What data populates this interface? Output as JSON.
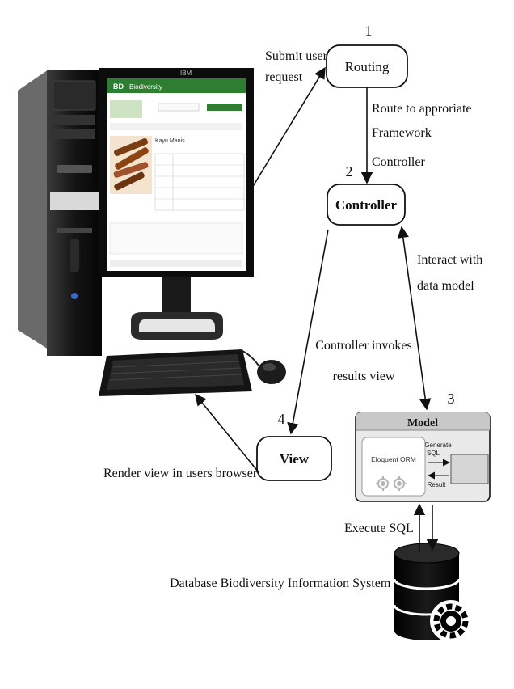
{
  "nodes": {
    "routing": {
      "number": "1",
      "label": "Routing"
    },
    "controller": {
      "number": "2",
      "label": "Controller"
    },
    "model": {
      "number": "3",
      "title": "Model",
      "orm_label": "Eloquent ORM"
    },
    "view": {
      "number": "4",
      "label": "View"
    }
  },
  "annotations": {
    "submit_line1": "Submit user",
    "submit_line2": "request",
    "route_line1": "Route to approriate",
    "route_line2": "Framework",
    "route_line3": "Controller",
    "interact_line1": "Interact with",
    "interact_line2": "data model",
    "invokes_line1": "Controller invokes",
    "invokes_line2": "results view",
    "render": "Render view in users browser",
    "execute_sql": "Execute SQL",
    "database": "Database Biodiversity Information System",
    "generate_line1": "Generate",
    "generate_line2": "SQL",
    "result": "Result"
  },
  "monitor_screen": {
    "brand": "BD",
    "site_title": "Biodiversity",
    "species_title": "Kayu Manis",
    "monitor_brand": "IBM"
  },
  "colors": {
    "app_header": "#2e7d32",
    "model_header": "#c8c8c8",
    "model_body": "#e9e9e9",
    "ink": "#111111"
  }
}
